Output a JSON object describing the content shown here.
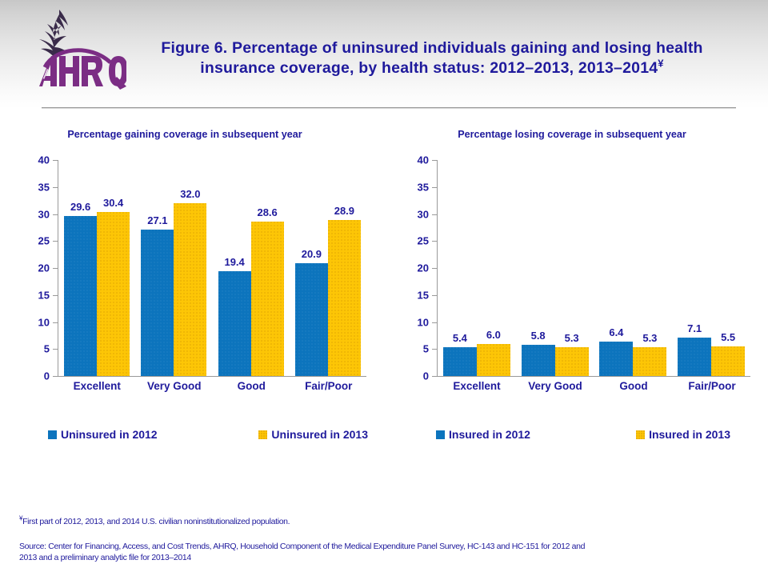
{
  "header": {
    "logo_name": "AHRQ",
    "logo_alt": "Agency for Healthcare Research and Quality",
    "title_line1": "Figure 6. Percentage of uninsured individuals gaining and losing health",
    "title_line2": "insurance coverage, by health status: 2012–2013, 2013–2014",
    "title_superscript": "¥",
    "title_color": "#1f1a9c"
  },
  "colors": {
    "series1": "#0c74bd",
    "series2": "#fdc606",
    "text": "#1f1a9c",
    "axis": "#9a9a9a"
  },
  "footnotes": {
    "symbol": "¥",
    "note": "First part of 2012, 2013, and 2014 U.S. civilian noninstitutionalized population.",
    "source_line1": "Source: Center for Financing, Access, and Cost Trends, AHRQ, Household Component of the Medical Expenditure Panel Survey,  HC-143 and HC-151 for 2012 and",
    "source_line2": "2013 and a preliminary analytic file for 2013–2014"
  },
  "chart_data": [
    {
      "id": "gaining",
      "type": "bar",
      "title": "Percentage gaining coverage in subsequent year",
      "xlabel": "",
      "ylabel": "",
      "ylim": [
        0,
        40
      ],
      "yticks": [
        0,
        5,
        10,
        15,
        20,
        25,
        30,
        35,
        40
      ],
      "grid": false,
      "legend_position": "bottom",
      "categories": [
        "Excellent",
        "Very Good",
        "Good",
        "Fair/Poor"
      ],
      "series": [
        {
          "name": "Uninsured in 2012",
          "color": "#0c74bd",
          "values": [
            29.6,
            27.1,
            19.4,
            20.9
          ]
        },
        {
          "name": "Uninsured in 2013",
          "color": "#fdc606",
          "values": [
            30.4,
            32.0,
            28.6,
            28.9
          ]
        }
      ]
    },
    {
      "id": "losing",
      "type": "bar",
      "title": "Percentage losing coverage in subsequent year",
      "xlabel": "",
      "ylabel": "",
      "ylim": [
        0,
        40
      ],
      "yticks": [
        0,
        5,
        10,
        15,
        20,
        25,
        30,
        35,
        40
      ],
      "grid": false,
      "legend_position": "bottom",
      "categories": [
        "Excellent",
        "Very Good",
        "Good",
        "Fair/Poor"
      ],
      "series": [
        {
          "name": "Insured in 2012",
          "color": "#0c74bd",
          "values": [
            5.4,
            5.8,
            6.4,
            7.1
          ]
        },
        {
          "name": "Insured in 2013",
          "color": "#fdc606",
          "values": [
            6.0,
            5.3,
            5.3,
            5.5
          ]
        }
      ]
    }
  ]
}
